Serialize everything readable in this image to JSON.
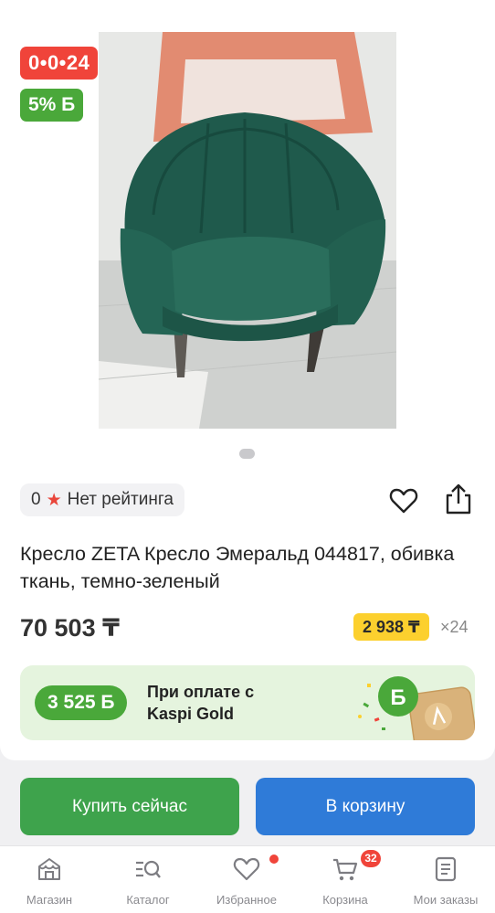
{
  "product": {
    "timer_badge": "0•0•24",
    "bonus_badge": "5% Б",
    "image_alt_icon": "armchair-photo",
    "rating": {
      "count": "0",
      "star_icon": "star-icon",
      "text": "Нет рейтинга"
    },
    "title": "Кресло ZETA Кресло Эмеральд 044817, обивка ткань, темно-зеленый",
    "price": "70 503 ₸",
    "installment": {
      "monthly": "2 938 ₸",
      "months": "×24"
    },
    "kaspi_gold": {
      "bonus": "3 525 Б",
      "line1": "При оплате с",
      "line2": "Kaspi Gold"
    }
  },
  "actions": {
    "buy_now": "Купить сейчас",
    "add_to_cart": "В корзину"
  },
  "nav": {
    "items": [
      {
        "label": "Магазин",
        "icon": "shop-icon"
      },
      {
        "label": "Каталог",
        "icon": "catalog-search-icon"
      },
      {
        "label": "Избранное",
        "icon": "heart-icon"
      },
      {
        "label": "Корзина",
        "icon": "cart-icon",
        "badge": "32"
      },
      {
        "label": "Мои заказы",
        "icon": "orders-icon"
      }
    ]
  },
  "colors": {
    "timer": "#f0443a",
    "bonus": "#4aa83a",
    "buy_button": "#3ea34c",
    "cart_button": "#2f7bd8",
    "installment": "#fcd02e",
    "gold_banner": "#e5f4de"
  }
}
